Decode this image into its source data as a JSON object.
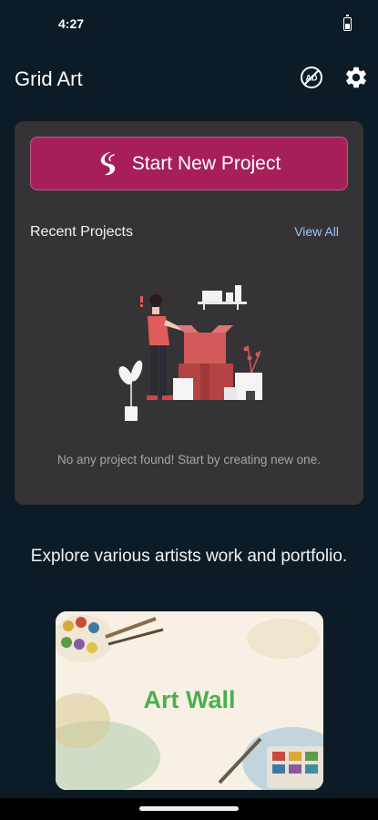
{
  "status_bar": {
    "time": "4:27"
  },
  "app_bar": {
    "title": "Grid Art",
    "noads_icon": "no-ads-icon",
    "noads_text": "AD",
    "settings_icon": "gear-icon"
  },
  "project_card": {
    "start_button_label": "Start New Project",
    "start_icon": "brush-logo-icon",
    "recent_title": "Recent Projects",
    "view_all_label": "View All",
    "empty_message": "No any project found! Start by creating new one.",
    "illustration": "empty-boxes-illustration"
  },
  "explore": {
    "text": "Explore various artists work and portfolio.",
    "art_wall_title": "Art Wall"
  },
  "colors": {
    "background": "#0d1b26",
    "card": "#363336",
    "accent": "#a61f5b",
    "link": "#9ec5ff",
    "art_wall_title": "#4caf50"
  }
}
